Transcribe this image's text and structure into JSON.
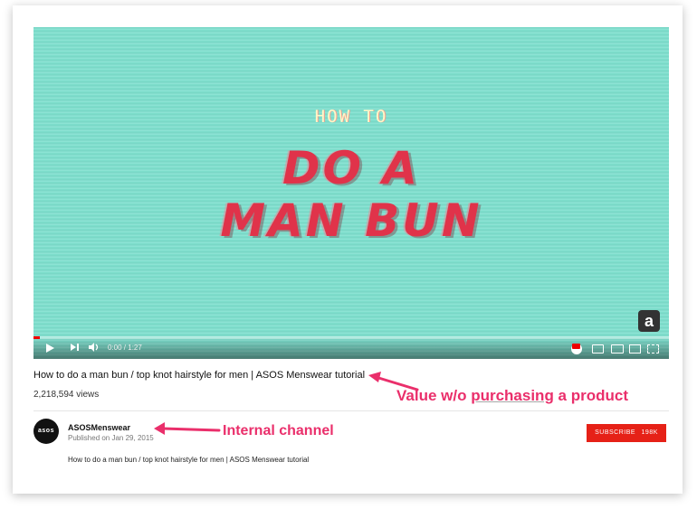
{
  "video": {
    "overlay_small": "HOW TO",
    "overlay_line1": "DO A",
    "overlay_line2": "MAN BUN",
    "badge": "a",
    "current_time": "0:00 / 1:27",
    "progress_fraction": 0.01,
    "icons": [
      "play-icon",
      "next-icon",
      "volume-icon",
      "settings-gear-icon",
      "miniplayer-icon",
      "theater-mode-icon",
      "cast-icon",
      "fullscreen-icon"
    ]
  },
  "info": {
    "title": "How to do a man bun / top knot hairstyle for men | ASOS Menswear tutorial",
    "views": "2,218,594 views",
    "channel": "ASOSMenswear",
    "avatar_text": "asos",
    "published": "Published on Jan 29, 2015",
    "description": "How to do a man bun / top knot hairstyle for men | ASOS Menswear tutorial",
    "subscribe_label": "SUBSCRIBE",
    "subscriber_count": "198K"
  },
  "annotations": {
    "value_prefix": "Value w/o ",
    "value_underlined": "purchasing",
    "value_suffix": " a product",
    "internal_channel": "Internal channel"
  },
  "colors": {
    "annotation": "#ea2f6b",
    "video_bg": "#7fe0cf",
    "title_red": "#e0334a",
    "subscribe": "#e62117"
  }
}
